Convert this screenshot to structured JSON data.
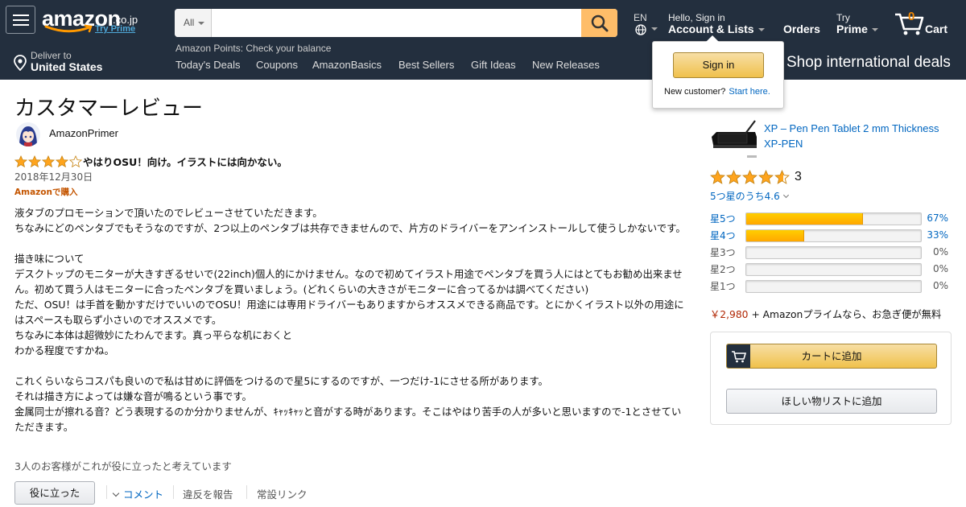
{
  "header": {
    "logo": "amazon",
    "logo_tld": ".co.jp",
    "try_prime": "Try Prime",
    "search": {
      "category": "All",
      "placeholder": "",
      "value": ""
    },
    "language": "EN",
    "greeting": "Hello, Sign in",
    "account_lists": "Account & Lists",
    "orders": "Orders",
    "try_label": "Try",
    "prime": "Prime",
    "cart_count": "0",
    "cart": "Cart",
    "points_label": "Amazon Points",
    "points_text": "Check your balance",
    "deliver_to": "Deliver to",
    "deliver_location": "United States",
    "nav_links": [
      "Today's Deals",
      "Coupons",
      "AmazonBasics",
      "Best Sellers",
      "Gift Ideas",
      "New Releases"
    ],
    "shop_international": "Shop international deals",
    "icons": {
      "menu": "hamburger-menu-icon",
      "search": "search-icon",
      "globe": "globe-icon",
      "location": "location-pin-icon",
      "cart": "cart-icon"
    },
    "colors": {
      "nav_bg": "#232f3e",
      "search_btn": "#febd69",
      "cart_count": "#f08804"
    }
  },
  "signin_popover": {
    "button": "Sign in",
    "new_customer": "New customer?",
    "start_here": "Start here."
  },
  "review": {
    "page_title": "カスタマーレビュー",
    "reviewer_name": "AmazonPrimer",
    "rating": 4,
    "max_rating": 5,
    "title": "やはりOSU！向け。イラストには向かない。",
    "date": "2018年12月30日",
    "verified": "Amazonで購入",
    "body": [
      "液タブのプロモーションで頂いたのでレビューさせていただきます。",
      "ちなみにどのペンタブでもそうなのですが、2つ以上のペンタブは共存できませんので、片方のドライバーをアンインストールして使うしかないです。",
      "",
      "描き味について",
      "デスクトップのモニターが大きすぎるせいで(22inch)個人的にかけません。なので初めてイラスト用途でペンタブを買う人にはとてもお勧め出来ません。初めて買う人はモニターに合ったペンタブを買いましょう。(どれくらいの大きさがモニターに合ってるかは調べてください)",
      "ただ、OSU！は手首を動かすだけでいいのでOSU！用途には専用ドライバーもありますからオススメできる商品です。とにかくイラスト以外の用途にはスペースも取らず小さいのでオススメです。",
      "ちなみに本体は超微妙にたわんでます。真っ平らな机におくと",
      "わかる程度ですかね。",
      "",
      "これくらいならコスパも良いので私は甘めに評価をつけるので星5にするのですが、一つだけ-1にさせる所があります。",
      "それは描き方によっては嫌な音が鳴るという事です。",
      "金属同士が擦れる音？どう表現するのか分かりませんが、ｷｬｯｷｬｯと音がする時があります。そこはやはり苦手の人が多いと思いますので-1とさせていただきます。"
    ],
    "helpful_count_text": "3人のお客様がこれが役に立ったと考えています",
    "helpful_button": "役に立った",
    "comment_link": "コメント",
    "report_link": "違反を報告",
    "permalink": "常設リンク"
  },
  "product": {
    "title": "XP – Pen Pen Tablet 2 mm Thickness",
    "brand": "XP-PEN",
    "average_rating": 4.6,
    "rating_count": "3",
    "rating_out_of": "5つ星のうち4.6",
    "histogram": [
      {
        "label": "星5つ",
        "percent_value": 67,
        "percent": "67%",
        "link": true
      },
      {
        "label": "星4つ",
        "percent_value": 33,
        "percent": "33%",
        "link": true
      },
      {
        "label": "星3つ",
        "percent_value": 0,
        "percent": "0%",
        "link": false
      },
      {
        "label": "星2つ",
        "percent_value": 0,
        "percent": "0%",
        "link": false
      },
      {
        "label": "星1つ",
        "percent_value": 0,
        "percent": "0%",
        "link": false
      }
    ],
    "price": "￥2,980",
    "prime_text": "+ Amazonプライムなら、お急ぎ便が無料",
    "add_to_cart": "カートに追加",
    "add_to_wishlist": "ほしい物リストに追加"
  },
  "colors": {
    "link": "#0066c0",
    "star": "#ffa41c",
    "verified": "#c45500",
    "price": "#b12704"
  }
}
